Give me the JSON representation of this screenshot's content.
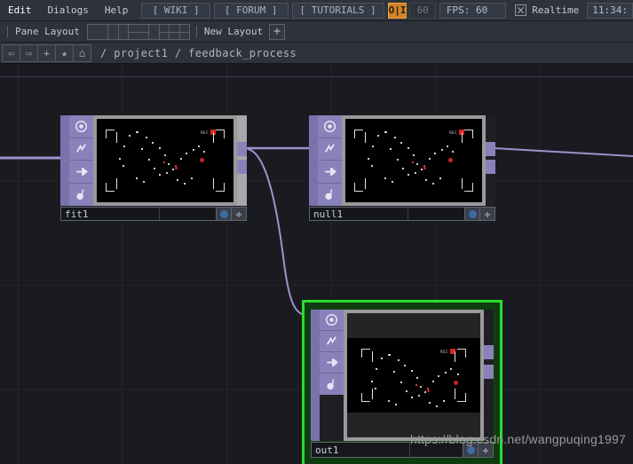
{
  "menubar": {
    "items": [
      {
        "label": "Edit",
        "name": "menu-edit"
      },
      {
        "label": "Dialogs",
        "name": "menu-dialogs"
      },
      {
        "label": "Help",
        "name": "menu-help"
      }
    ],
    "wiki_label": "[ WIKI ]",
    "forum_label": "[ FORUM ]",
    "tutorials_label": "[ TUTORIALS ]",
    "oi_toggle_label": "O|I",
    "oi_toggle_color": "#d2832b",
    "frame_value": "60",
    "fps_label": "FPS: 60",
    "realtime_label": "Realtime",
    "clock": "11:34:"
  },
  "panebar": {
    "pane_layout_label": "Pane Layout",
    "layout_options": [
      "single-pane",
      "two-column-pane",
      "two-row-pane",
      "three-pane",
      "four-pane"
    ],
    "new_layout_label": "New Layout",
    "new_layout_plus": "+"
  },
  "pathbar": {
    "back_icon": "⇦",
    "forward_icon": "⇨",
    "add_icon": "+",
    "favorite_icon": "★",
    "home_icon": "⌂",
    "path": "/ project1 / feedback_process"
  },
  "canvas": {
    "background_color": "#191b20",
    "grid_color": "#24262c",
    "selection_color": "#2bdb2b",
    "wire_color": "#9b93cc"
  },
  "nodes": [
    {
      "name": "fit1",
      "selected": false,
      "icons": [
        "display-flag-icon",
        "template-flag-icon",
        "render-flag-icon",
        "bypass-flag-icon"
      ],
      "footer_dot": "blue-dot-icon",
      "footer_cross": "✚",
      "viewport": {
        "rec_label": "REC"
      }
    },
    {
      "name": "null1",
      "selected": false,
      "icons": [
        "display-flag-icon",
        "template-flag-icon",
        "render-flag-icon",
        "bypass-flag-icon"
      ],
      "footer_dot": "blue-dot-icon",
      "footer_cross": "✚",
      "viewport": {
        "rec_label": "REC"
      }
    },
    {
      "name": "out1",
      "selected": true,
      "icons": [
        "display-flag-icon",
        "template-flag-icon",
        "render-flag-icon",
        "bypass-flag-icon"
      ],
      "footer_dot": "blue-dot-icon",
      "footer_cross": "✚",
      "viewport": {
        "rec_label": "REC"
      }
    }
  ],
  "watermark": "https://blog.csdn.net/wangpuqing1997"
}
